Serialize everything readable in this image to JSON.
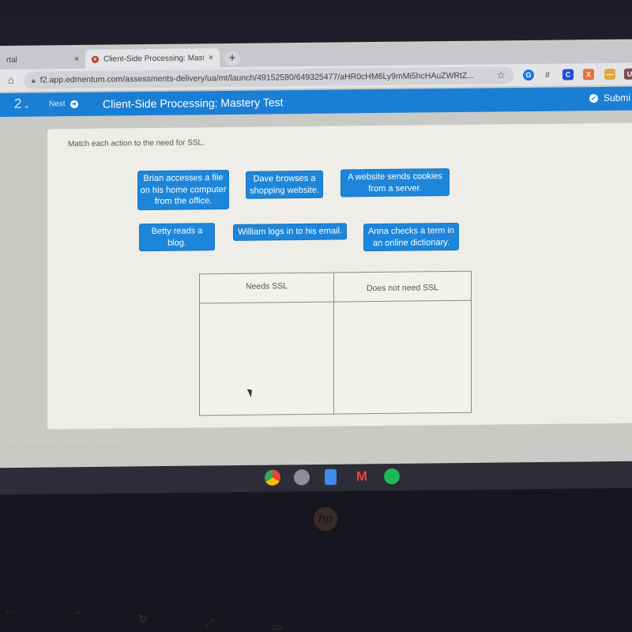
{
  "browser": {
    "tabs": [
      {
        "title": "rtal",
        "active": false
      },
      {
        "title": "Client-Side Processing: Mastery",
        "active": true
      }
    ],
    "new_tab_label": "+",
    "close_label": "×",
    "url": "f2.app.edmentum.com/assessments-delivery/ua/mt/launch/49152580/649325477/aHR0cHM6Ly9mMi5hcHAuZWRtZ...",
    "extensions": [
      {
        "name": "google-ext",
        "label": "G",
        "color": "#1a73e8"
      },
      {
        "name": "bars-ext",
        "label": "//",
        "color": "#6b6b6b"
      },
      {
        "name": "c-ext",
        "label": "C",
        "color": "#1f4fd8"
      },
      {
        "name": "orange-ext",
        "label": "X",
        "color": "#ee6a3a"
      },
      {
        "name": "yellow-ext",
        "label": "—",
        "color": "#e3a73b"
      },
      {
        "name": "profile-ext",
        "label": "U",
        "color": "#7a4a4a"
      }
    ]
  },
  "app_header": {
    "question_number": "2",
    "next_label": "Next",
    "title": "Client-Side Processing: Mastery Test",
    "submit_label": "Submi",
    "color": "#1a7fd4"
  },
  "question": {
    "prompt": "Match each action to the need for SSL.",
    "tiles": [
      {
        "text": "Brian accesses a file on his home computer from the office."
      },
      {
        "text": "Dave browses a shopping website."
      },
      {
        "text": "A website sends cookies from a server."
      },
      {
        "text": "Betty reads a blog."
      },
      {
        "text": "William logs in to his email."
      },
      {
        "text": "Anna checks a term in an online dictionary."
      }
    ],
    "columns": [
      {
        "header": "Needs SSL"
      },
      {
        "header": "Does not need SSL"
      }
    ]
  },
  "footer": {
    "copyright": "©2021 Edmentum. All rights reserved."
  },
  "shelf": {
    "apps": [
      "chrome",
      "camera",
      "docs",
      "gmail",
      "spotify"
    ]
  },
  "laptop": {
    "brand": "hp"
  }
}
